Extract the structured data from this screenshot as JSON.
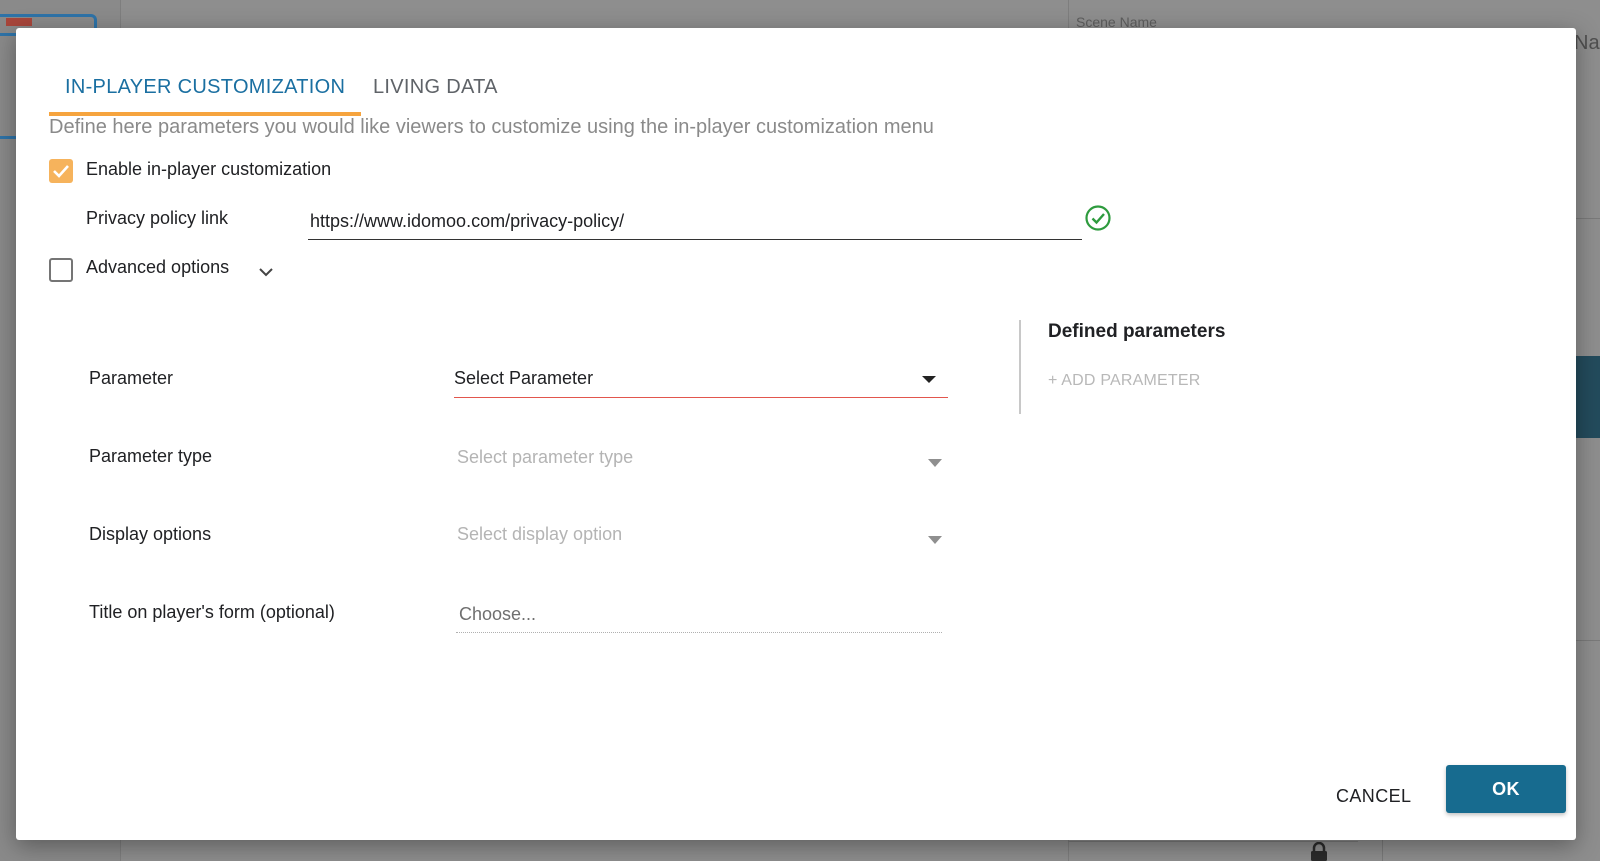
{
  "background": {
    "scene_name_label": "Scene Name",
    "partial_label": "Na",
    "icons": {
      "lock": "lock-icon"
    }
  },
  "dialog": {
    "tabs": [
      {
        "label": "IN-PLAYER CUSTOMIZATION",
        "active": true
      },
      {
        "label": "LIVING DATA",
        "active": false
      }
    ],
    "description": "Define here parameters you would like viewers to customize using the in-player customization menu",
    "enable_customization": {
      "label": "Enable in-player customization",
      "checked": true
    },
    "privacy_policy": {
      "label": "Privacy policy link",
      "value": "https://www.idomoo.com/privacy-policy/",
      "valid_icon": "check-circle-icon"
    },
    "advanced_options": {
      "label": "Advanced options",
      "checked": false,
      "expand_icon": "chevron-down-icon"
    },
    "form": {
      "parameter": {
        "label": "Parameter",
        "value": "Select Parameter"
      },
      "parameter_type": {
        "label": "Parameter type",
        "placeholder": "Select parameter type"
      },
      "display_options": {
        "label": "Display options",
        "placeholder": "Select display option"
      },
      "title_on_form": {
        "label": "Title on player's form (optional)",
        "placeholder": "Choose..."
      }
    },
    "defined_parameters": {
      "title": "Defined parameters",
      "add_label": "+ ADD PARAMETER"
    },
    "buttons": {
      "cancel": "CANCEL",
      "ok": "OK"
    },
    "colors": {
      "accent": "#1a6fa1",
      "tab_indicator": "#f6a43e",
      "checkbox_checked": "#f6b35c",
      "error_underline": "#e2564d",
      "valid": "#2e9b3e",
      "primary_button": "#176b8f"
    }
  }
}
